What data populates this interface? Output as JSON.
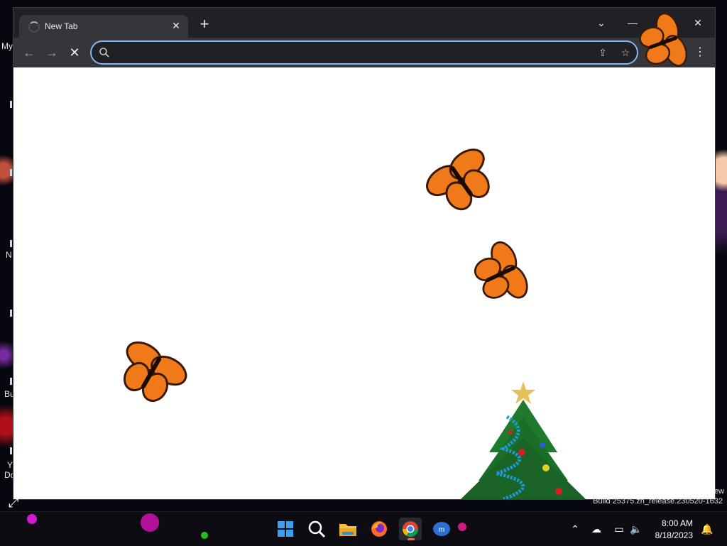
{
  "browser": {
    "tab_title": "New Tab",
    "tab_close_icon": "close-icon",
    "new_tab_icon": "plus-icon",
    "tab_search_icon": "chevron-down-icon",
    "minimize_icon": "minimize-icon",
    "maximize_icon": "maximize-icon",
    "close_window_icon": "close-icon",
    "back_icon": "arrow-left-icon",
    "forward_icon": "arrow-right-icon",
    "stop_icon": "stop-icon",
    "address_value": "",
    "address_placeholder": "",
    "share_icon": "share-icon",
    "bookmark_icon": "star-icon",
    "profile_icon": "profile-icon",
    "menu_icon": "kebab-menu-icon",
    "omnibox_focus_color": "#8ab4f8"
  },
  "desktop": {
    "fragments": [
      "My",
      "N",
      "Bu",
      "Y",
      "Do"
    ],
    "watermark_line1": "ew",
    "watermark_line2": "Build 25375.zn_release.230520-1632"
  },
  "overlay": {
    "butterfly_count": 5,
    "butterfly_color": "#f07a1a",
    "decoration": "christmas-tree"
  },
  "taskbar": {
    "apps": [
      "start-icon",
      "search-icon",
      "file-explorer-icon",
      "firefox-icon",
      "chrome-icon",
      "app-icon"
    ],
    "active_app": "chrome-icon",
    "tray_icons": [
      "chevron-up-icon",
      "cloud-offline-icon",
      "network-icon",
      "volume-icon",
      "notification-icon"
    ],
    "time": "8:00 AM",
    "date": "8/18/2023"
  }
}
